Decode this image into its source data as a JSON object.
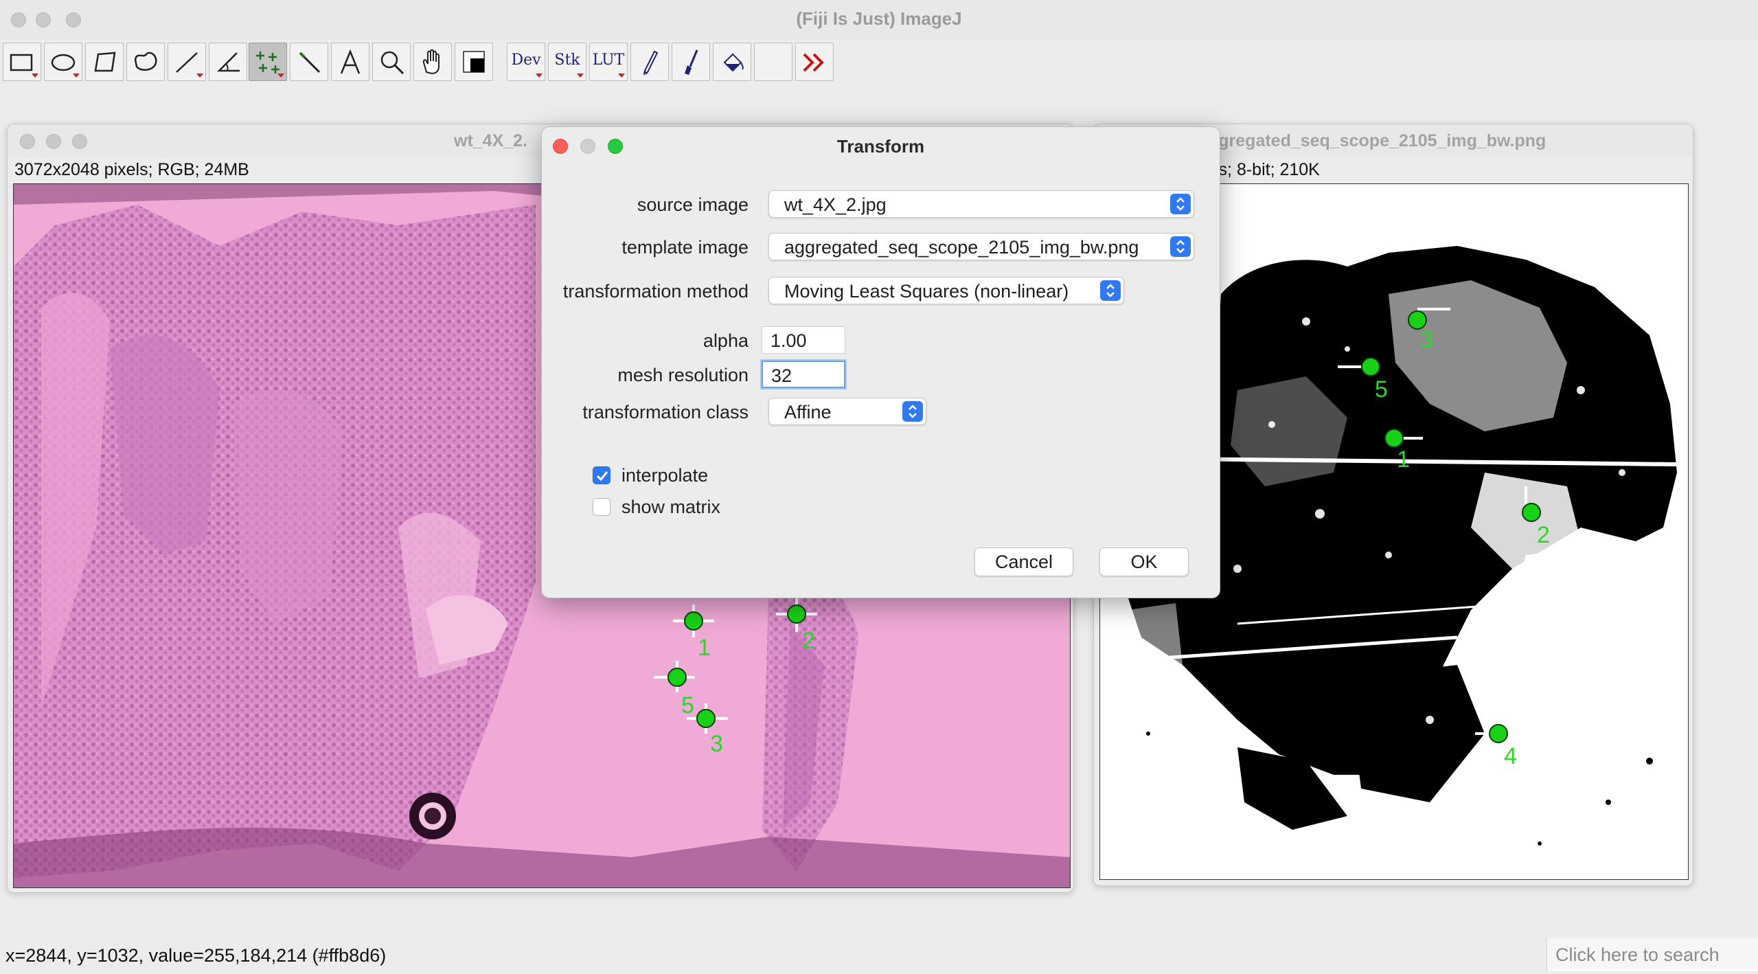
{
  "app": {
    "title": "(Fiji Is Just) ImageJ"
  },
  "toolbar": {
    "tools": [
      {
        "icon": "rectangle-selection-icon"
      },
      {
        "icon": "oval-selection-icon"
      },
      {
        "icon": "polygon-selection-icon"
      },
      {
        "icon": "freehand-selection-icon"
      },
      {
        "icon": "line-selection-icon"
      },
      {
        "icon": "angle-tool-icon"
      },
      {
        "icon": "multipoint-tool-icon",
        "selected": true
      },
      {
        "icon": "wand-tool-icon"
      },
      {
        "icon": "text-tool-icon",
        "glyph": "A"
      },
      {
        "icon": "magnifier-icon"
      },
      {
        "icon": "hand-tool-icon"
      },
      {
        "icon": "color-picker-icon"
      },
      {
        "label": "Dev"
      },
      {
        "label": "Stk"
      },
      {
        "label": "LUT"
      },
      {
        "icon": "pencil-icon"
      },
      {
        "icon": "brush-icon"
      },
      {
        "icon": "flood-fill-icon"
      },
      {
        "icon": "blank-slot-icon"
      },
      {
        "icon": "more-tools-icon",
        "glyph": "≫"
      }
    ]
  },
  "left_window": {
    "title": "wt_4X_2.",
    "info": "3072x2048 pixels; RGB; 24MB",
    "markers": [
      "1",
      "2",
      "5",
      "3"
    ]
  },
  "right_window": {
    "title": "ggregated_seq_scope_2105_img_bw.png",
    "info": "ls; 8-bit; 210K",
    "markers": [
      "3",
      "5",
      "1",
      "2",
      "4"
    ]
  },
  "dialog": {
    "title": "Transform",
    "source_label": "source image",
    "source_value": "wt_4X_2.jpg",
    "template_label": "template image",
    "template_value": "aggregated_seq_scope_2105_img_bw.png",
    "method_label": "transformation method",
    "method_value": "Moving Least Squares (non-linear)",
    "alpha_label": "alpha",
    "alpha_value": "1.00",
    "mesh_label": "mesh resolution",
    "mesh_value": "32",
    "class_label": "transformation class",
    "class_value": "Affine",
    "interpolate_label": "interpolate",
    "interpolate_checked": true,
    "show_matrix_label": "show matrix",
    "show_matrix_checked": false,
    "cancel_label": "Cancel",
    "ok_label": "OK"
  },
  "status": {
    "text": "x=2844, y=1032, value=255,184,214 (#ffb8d6)",
    "search_placeholder": "Click here to search"
  },
  "colors": {
    "accent": "#2f7af2",
    "marker": "#19d119",
    "tissue": "#e9a4cf",
    "tissue_dark": "#a84b9a"
  }
}
